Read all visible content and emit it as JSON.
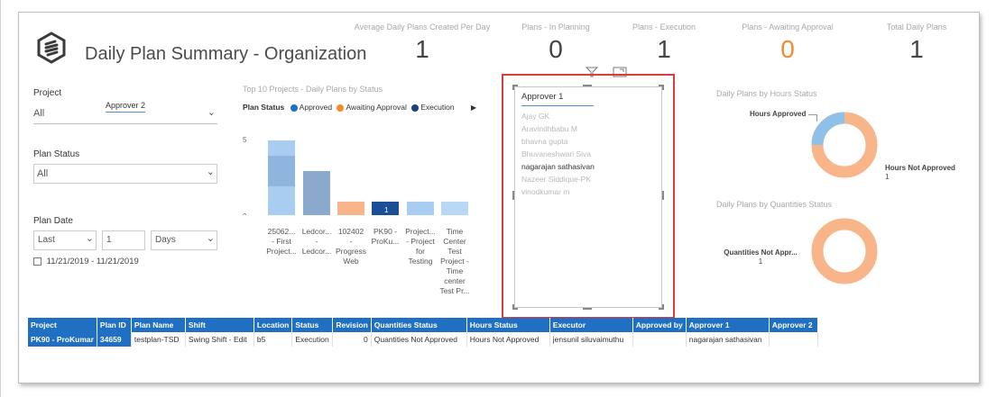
{
  "header": {
    "title": "Daily Plan Summary - Organization"
  },
  "kpis": [
    {
      "label": "Average Daily Plans Created Per Day",
      "value": "1",
      "color": "#444444"
    },
    {
      "label": "Plans - In Planning",
      "value": "0",
      "color": "#444444"
    },
    {
      "label": "Plans - Execution",
      "value": "1",
      "color": "#444444"
    },
    {
      "label": "Plans - Awaiting Approval",
      "value": "0",
      "color": "#f28a2e"
    },
    {
      "label": "Total Daily Plans",
      "value": "1",
      "color": "#444444"
    }
  ],
  "filters": {
    "project_label": "Project",
    "project_value": "All",
    "project_tooltip": "Approver 2",
    "status_label": "Plan Status",
    "status_value": "All",
    "date_label": "Plan Date",
    "date_mode": "Last",
    "date_count": "1",
    "date_unit": "Days",
    "date_range": "11/21/2019 - 11/21/2019"
  },
  "bar_chart": {
    "title": "Top 10 Projects - Daily Plans by Status",
    "legend_title": "Plan Status",
    "legend": [
      {
        "name": "Approved",
        "color": "#1f6fc2"
      },
      {
        "name": "Awaiting Approval",
        "color": "#f28a2e"
      },
      {
        "name": "Execution",
        "color": "#1a3f7a"
      }
    ],
    "y_ticks": [
      "5",
      "0"
    ],
    "bar_value_label": "1",
    "categories": [
      "25062...\n- First\nProject...",
      "Ledcor...\n-\nLedcor...",
      "102402\n-\nProgress\nWeb",
      "PK90 -\nProKu...",
      "Project...\n- Project\nfor\nTesting",
      "Time\nCenter\nTest\nProject -\nTime\ncenter\nTest Pr..."
    ]
  },
  "chart_data": {
    "type": "bar",
    "categories": [
      "25062... - First Project...",
      "Ledcor... - Ledcor...",
      "102402 - Progress Web",
      "PK90 - ProKu...",
      "Project... - Project for Testing",
      "Time Center Test Project - Time center Test Pr..."
    ],
    "series": [
      {
        "name": "Approved",
        "values": [
          5,
          3,
          0,
          0,
          1,
          1
        ]
      },
      {
        "name": "Awaiting Approval",
        "values": [
          0,
          0,
          1,
          0,
          0,
          0
        ]
      },
      {
        "name": "Execution",
        "values": [
          0,
          0,
          0,
          1,
          0,
          0
        ]
      }
    ],
    "ylim": [
      0,
      5
    ]
  },
  "slicer": {
    "title": "Approver 1",
    "items": [
      {
        "name": "Ajay GK",
        "active": false
      },
      {
        "name": "Aravindhbabu M",
        "active": false
      },
      {
        "name": "bhavna gupta",
        "active": false
      },
      {
        "name": "Bhuvaneshwari Siva",
        "active": false
      },
      {
        "name": "nagarajan sathasivan",
        "active": true
      },
      {
        "name": "Nazeer Siddique-PK",
        "active": false
      },
      {
        "name": "vinodkumar m",
        "active": false
      }
    ]
  },
  "donut_hours": {
    "title": "Daily Plans by Hours Status",
    "label_approved": "Hours Approved",
    "label_not_approved": "Hours Not Approved",
    "label_not_approved_value": "1",
    "colors": {
      "approved": "#8fc0e8",
      "not_approved": "#f8b58a"
    }
  },
  "donut_quantities": {
    "title": "Daily Plans by Quantities Status",
    "label": "Quantities Not Appr...",
    "label_value": "1",
    "colors": {
      "ring": "#f8b58a"
    }
  },
  "table": {
    "headers": [
      "Project",
      "Plan ID",
      "Plan Name",
      "Shift",
      "Location",
      "Status",
      "Revision",
      "Quantities Status",
      "Hours Status",
      "Executor",
      "Approved by",
      "Approver 1",
      "Approver 2"
    ],
    "rows": [
      [
        "PK90 - ProKumar",
        "34659",
        "testplan-TSD",
        "Swing Shift - Edit",
        "b5",
        "Execution",
        "0",
        "Quantities Not Approved",
        "Hours Not Approved",
        "jensunil siluvaimuthu",
        "",
        "nagarajan sathasivan",
        ""
      ]
    ]
  }
}
